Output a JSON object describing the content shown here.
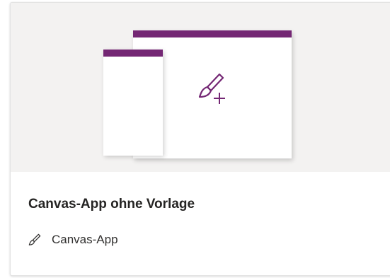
{
  "card": {
    "title": "Canvas-App ohne Vorlage",
    "type_label": "Canvas-App"
  },
  "icons": {
    "preview": "paintbrush-add-icon",
    "type": "paintbrush-icon"
  },
  "colors": {
    "accent": "#742774",
    "hero_background": "#f3f2f1"
  }
}
